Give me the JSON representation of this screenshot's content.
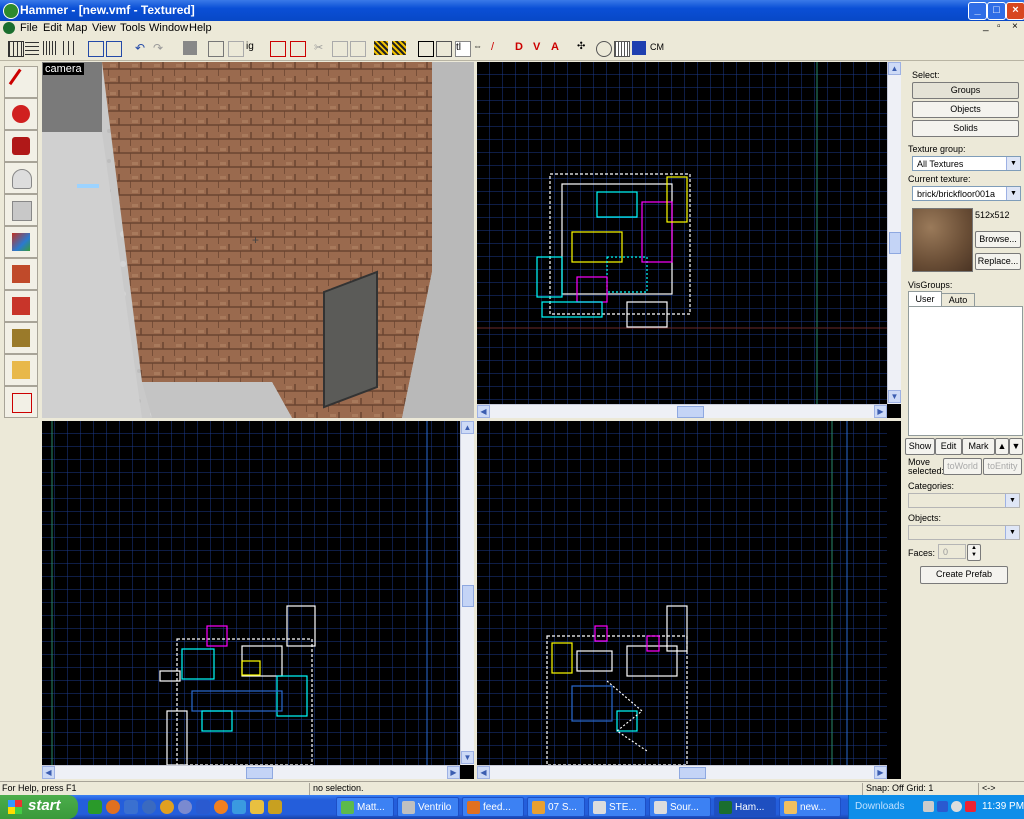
{
  "window": {
    "title": "Hammer - [new.vmf - Textured]",
    "controls": [
      "_",
      "□",
      "×"
    ]
  },
  "menu": [
    "File",
    "Edit",
    "Map",
    "View",
    "Tools",
    "Window",
    "Help"
  ],
  "toolbar": {
    "cm_label": "CM"
  },
  "viewports": {
    "camera_label": "camera"
  },
  "right_panel": {
    "select_label": "Select:",
    "groups_label": "Groups",
    "objects_label": "Objects",
    "solids_label": "Solids",
    "texture_group_label": "Texture group:",
    "texture_group_value": "All Textures",
    "current_texture_label": "Current texture:",
    "current_texture_value": "brick/brickfloor001a",
    "texture_size": "512x512",
    "browse_label": "Browse...",
    "replace_label": "Replace...",
    "visgroups_label": "VisGroups:",
    "tab_user": "User",
    "tab_auto": "Auto",
    "show_label": "Show",
    "edit_label": "Edit",
    "mark_label": "Mark",
    "move_selected_label_1": "Move",
    "move_selected_label_2": "selected:",
    "to_world_label": "toWorld",
    "to_entity_label": "toEntity",
    "categories_label": "Categories:",
    "objects_field_label": "Objects:",
    "faces_label": "Faces:",
    "faces_value": "0",
    "create_prefab_label": "Create Prefab"
  },
  "status": {
    "help": "For Help, press F1",
    "selection": "no selection.",
    "snap": "Snap: Off Grid: 1",
    "extra": "<->"
  },
  "taskbar": {
    "start_label": "start",
    "tasks": [
      "Matt...",
      "Ventrilo",
      "feed...",
      "07 S...",
      "STE...",
      "Sour...",
      "Ham...",
      "new..."
    ],
    "downloads_label": "Downloads",
    "clock": "11:39 PM"
  },
  "colors": {
    "titlebar": "#0a4fd6",
    "grid_line": "#1c3a8a",
    "brush_white": "#ffffff",
    "brush_cyan": "#00ffff",
    "brush_magenta": "#ff00ff",
    "brush_yellow": "#ffff00"
  }
}
